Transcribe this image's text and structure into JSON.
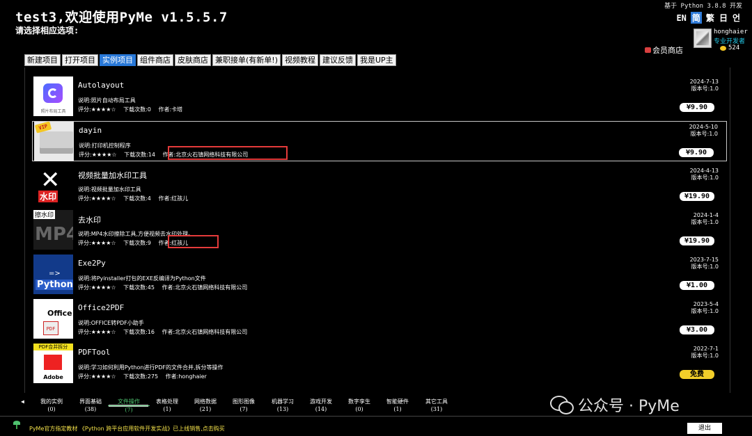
{
  "header": {
    "title": "test3,欢迎使用PyMe v1.5.5.7",
    "subtitle": "请选择相应选项:",
    "python_info": "基于 Python 3.8.8 开发",
    "languages": [
      "EN",
      "简",
      "繁",
      "日",
      "언"
    ],
    "active_language_index": 1
  },
  "user": {
    "name": "honghaier",
    "role": "专业开发者",
    "coins": "524"
  },
  "vip_store": "会员商店",
  "tabs": [
    "新建项目",
    "打开项目",
    "实例项目",
    "组件商店",
    "皮肤商店",
    "兼职接单(有新单!)",
    "视频教程",
    "建议反馈",
    "我是UP主"
  ],
  "active_tab_index": 2,
  "projects": [
    {
      "name": "Autolayout",
      "thumb_caption": "照片布局工具",
      "desc": "说明:照片自动布局工具",
      "rating": "评分:★★★★☆",
      "downloads": "下载次数:0",
      "author": "作者:卡塔",
      "date": "2024-7-13",
      "version": "版本号:1.0",
      "price": "¥9.90"
    },
    {
      "name": "dayin",
      "thumb_caption": "VIP",
      "desc": "说明:打印机控制程序",
      "rating": "评分:★★★★☆",
      "downloads": "下载次数:14",
      "author": "作者:北京火石镇网络科技有限公司",
      "date": "2024-5-10",
      "version": "版本号:1.0",
      "price": "¥9.90"
    },
    {
      "name": "视频批量加水印工具",
      "thumb_caption": "水印",
      "desc": "说明:视频批量加水印工具",
      "rating": "评分:★★★★☆",
      "downloads": "下载次数:4",
      "author": "作者:红孩儿",
      "date": "2024-4-13",
      "version": "版本号:1.0",
      "price": "¥19.90"
    },
    {
      "name": "去水印",
      "thumb_caption": "擦水印",
      "desc": "说明:MP4水印擦除工具,方便视频去水印处理。",
      "rating": "评分:★★★★☆",
      "downloads": "下载次数:9",
      "author": "作者:红孩儿",
      "date": "2024-1-4",
      "version": "版本号:1.0",
      "price": "¥19.90"
    },
    {
      "name": "Exe2Py",
      "thumb_caption": "Python",
      "desc": "说明:将Pyinstaller打包的EXE反编译为Python文件",
      "rating": "评分:★★★★☆",
      "downloads": "下载次数:45",
      "author": "作者:北京火石镇网络科技有限公司",
      "date": "2023-7-15",
      "version": "版本号:1.0",
      "price": "¥1.00"
    },
    {
      "name": "Office2PDF",
      "thumb_caption": "Office",
      "desc": "说明:OFFICE转PDF小助手",
      "rating": "评分:★★★★☆",
      "downloads": "下载次数:16",
      "author": "作者:北京火石镇网络科技有限公司",
      "date": "2023-5-4",
      "version": "版本号:1.0",
      "price": "¥3.00"
    },
    {
      "name": "PDFTool",
      "thumb_caption": "PDF合并拆分",
      "desc": "说明:学习如何利用Python进行PDF的文件合并,拆分等操作",
      "rating": "评分:★★★★☆",
      "downloads": "下载次数:275",
      "author": "作者:honghaier",
      "date": "2022-7-1",
      "version": "版本号:1.0",
      "price": "免费"
    }
  ],
  "thumb_texts": {
    "mp4": "MP4",
    "arrow": "=>",
    "pdf_mini": "PDF",
    "adobe": "Adobe"
  },
  "categories": [
    {
      "label": "我的实例",
      "count": "(0)"
    },
    {
      "label": "界面基础",
      "count": "(38)"
    },
    {
      "label": "文件操作",
      "count": "(7)"
    },
    {
      "label": "表格处理",
      "count": "(1)"
    },
    {
      "label": "网络数据",
      "count": "(21)"
    },
    {
      "label": "图形图像",
      "count": "(7)"
    },
    {
      "label": "机器学习",
      "count": "(13)"
    },
    {
      "label": "游戏开发",
      "count": "(14)"
    },
    {
      "label": "数字孪生",
      "count": "(0)"
    },
    {
      "label": "智能硬件",
      "count": "(1)"
    },
    {
      "label": "其它工具",
      "count": "(31)"
    }
  ],
  "active_category_index": 2,
  "footer": {
    "promo": "PyMe官方指定教材 《Python 跨平台应用软件开发实战》已上线销售,点击购买",
    "exit_label": "退出"
  },
  "watermark": "公众号 · PyMe",
  "colors": {
    "accent": "#2878d8",
    "highlight": "#e53b3b",
    "role": "#22c7e6",
    "promo": "#f2e04a",
    "free_badge": "#f2cf2a",
    "active_category": "#4fc26f"
  }
}
